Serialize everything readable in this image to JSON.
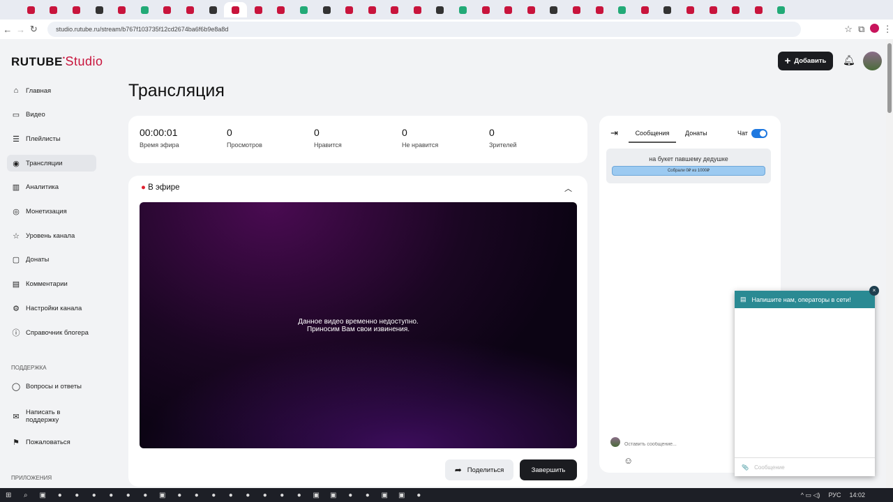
{
  "browser": {
    "url": "studio.rutube.ru/stream/b767f103735f12cd2674ba6f6b9e8a8d",
    "tab_count": 34,
    "active_tab": 9
  },
  "logo": {
    "brand": "RUTUBE",
    "product": "Studio"
  },
  "header": {
    "add_label": "Добавить"
  },
  "sidebar": {
    "items": [
      {
        "icon": "home-icon",
        "glyph": "⌂",
        "label": "Главная"
      },
      {
        "icon": "video-icon",
        "glyph": "▭",
        "label": "Видео"
      },
      {
        "icon": "playlist-icon",
        "glyph": "☰",
        "label": "Плейлисты"
      },
      {
        "icon": "broadcast-icon",
        "glyph": "◉",
        "label": "Трансляции"
      },
      {
        "icon": "analytics-icon",
        "glyph": "▥",
        "label": "Аналитика"
      },
      {
        "icon": "monetization-icon",
        "glyph": "◎",
        "label": "Монетизация"
      },
      {
        "icon": "star-icon",
        "glyph": "☆",
        "label": "Уровень канала"
      },
      {
        "icon": "donate-icon",
        "glyph": "▢",
        "label": "Донаты"
      },
      {
        "icon": "comments-icon",
        "glyph": "▤",
        "label": "Комментарии"
      },
      {
        "icon": "settings-icon",
        "glyph": "⚙",
        "label": "Настройки канала"
      },
      {
        "icon": "guide-icon",
        "glyph": "ⓘ",
        "label": "Справочник блогера"
      }
    ],
    "support_heading": "ПОДДЕРЖКА",
    "support": [
      {
        "icon": "faq-icon",
        "glyph": "◯",
        "label": "Вопросы и ответы"
      },
      {
        "icon": "mail-icon",
        "glyph": "✉",
        "label": "Написать в поддержку"
      },
      {
        "icon": "flag-icon",
        "glyph": "⚑",
        "label": "Пожаловаться"
      }
    ],
    "apps_heading": "ПРИЛОЖЕНИЯ"
  },
  "page": {
    "title": "Трансляция"
  },
  "stats": [
    {
      "value": "00:00:01",
      "label": "Время эфира"
    },
    {
      "value": "0",
      "label": "Просмотров"
    },
    {
      "value": "0",
      "label": "Нравится"
    },
    {
      "value": "0",
      "label": "Не нравится"
    },
    {
      "value": "0",
      "label": "Зрителей"
    }
  ],
  "live": {
    "status": "В эфире",
    "status_color": "#e0202e",
    "message_line1": "Данное видео временно недоступно.",
    "message_line2": "Приносим Вам свои извинения.",
    "share_label": "Поделиться",
    "finish_label": "Завершить"
  },
  "chat": {
    "tabs": [
      "Сообщения",
      "Донаты"
    ],
    "toggle_label": "Чат",
    "toggle_on": true,
    "goal_title": "на букет павшему дедушке",
    "goal_progress": "Собрали 0₽ из 1000₽",
    "goal_fraction": 0,
    "input_placeholder": "Оставить сообщение..."
  },
  "support_widget": {
    "title": "Напишите нам, операторы в сети!",
    "input_placeholder": "Сообщение",
    "color": "#2a8a93"
  },
  "taskbar": {
    "lang": "РУС",
    "time": "14:02"
  }
}
